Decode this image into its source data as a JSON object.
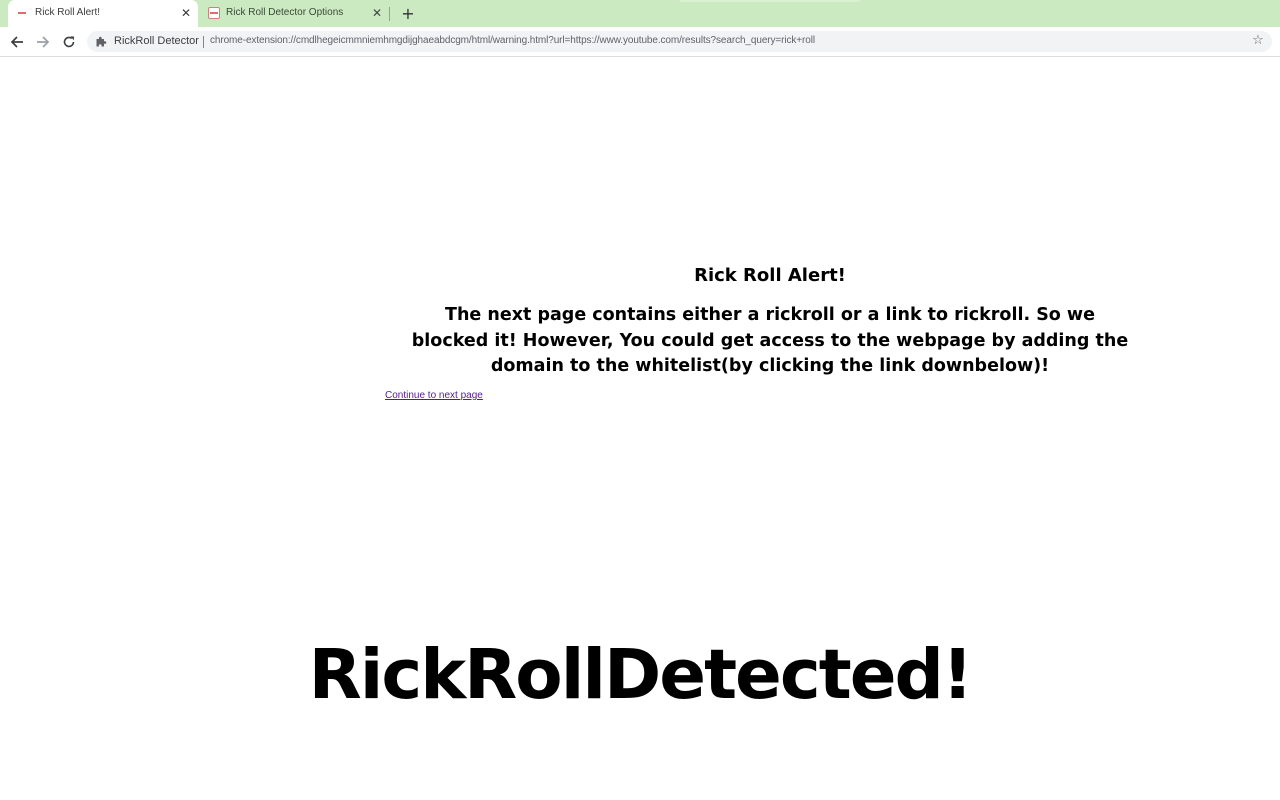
{
  "browser": {
    "tabs": [
      {
        "title": "Rick Roll Alert!",
        "active": true
      },
      {
        "title": "Rick Roll Detector Options",
        "active": false
      }
    ],
    "new_tab_label": "+",
    "close_glyph": "✕",
    "nav": {
      "back_icon": "arrow-left-icon",
      "forward_icon": "arrow-right-icon",
      "reload_icon": "reload-icon"
    },
    "omnibox": {
      "extension_chip": "RickRoll Detector",
      "url": "chrome-extension://cmdlhegeicmmniemhmgdijghaeabdcgm/html/warning.html?url=https://www.youtube.com/results?search_query=rick+roll",
      "star_glyph": "☆"
    },
    "colors": {
      "tabstrip": "#cbeac1",
      "toolbar": "#ffffff",
      "omnibox": "#f1f3f4"
    }
  },
  "page": {
    "heading": "Rick Roll Alert!",
    "message": "The next page contains either a rickroll or a link to rickroll. So we blocked it! However, You could get access to the webpage by adding the domain to the whitelist(by clicking the link downbelow)!",
    "continue_link": "Continue to next page",
    "banner": "RickRollDetected!",
    "colors": {
      "text": "#000000",
      "link_visited": "#551a8b"
    }
  }
}
